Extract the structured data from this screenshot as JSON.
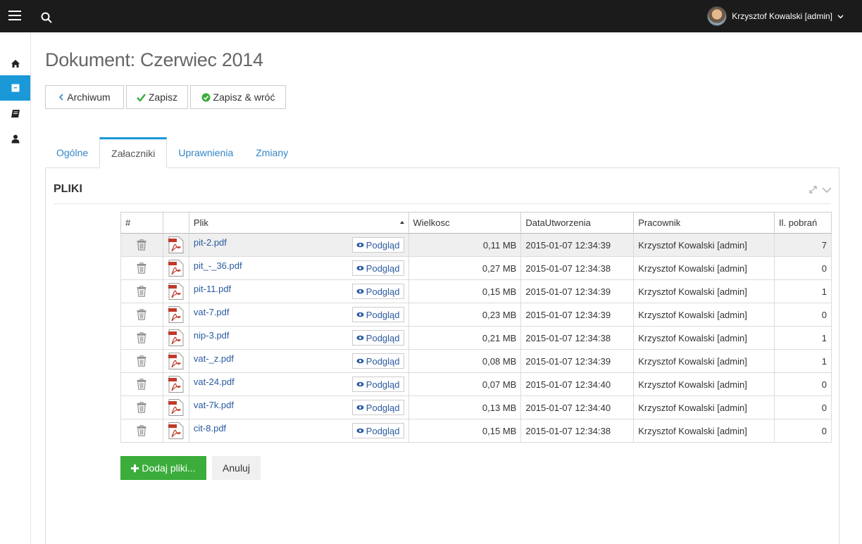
{
  "topbar": {
    "user_name": "Krzysztof Kowalski [admin]"
  },
  "page": {
    "title": "Dokument: Czerwiec 2014"
  },
  "toolbar": {
    "archive_label": "Archiwum",
    "save_label": "Zapisz",
    "save_back_label": "Zapisz & wróć"
  },
  "tabs": [
    {
      "label": "Ogólne"
    },
    {
      "label": "Załaczniki"
    },
    {
      "label": "Uprawnienia"
    },
    {
      "label": "Zmiany"
    }
  ],
  "panel": {
    "title": "PLIKI"
  },
  "table": {
    "headers": {
      "index": "#",
      "file": "Plik",
      "size": "Wielkosc",
      "created": "DataUtworzenia",
      "employee": "Pracownik",
      "downloads": "Il. pobrań"
    },
    "preview_label": "Podgląd",
    "rows": [
      {
        "file": "pit-2.pdf",
        "size": "0,11 MB",
        "created": "2015-01-07 12:34:39",
        "employee": "Krzysztof Kowalski [admin]",
        "downloads": "7"
      },
      {
        "file": "pit_-_36.pdf",
        "size": "0,27 MB",
        "created": "2015-01-07 12:34:38",
        "employee": "Krzysztof Kowalski [admin]",
        "downloads": "0"
      },
      {
        "file": "pit-11.pdf",
        "size": "0,15 MB",
        "created": "2015-01-07 12:34:39",
        "employee": "Krzysztof Kowalski [admin]",
        "downloads": "1"
      },
      {
        "file": "vat-7.pdf",
        "size": "0,23 MB",
        "created": "2015-01-07 12:34:39",
        "employee": "Krzysztof Kowalski [admin]",
        "downloads": "0"
      },
      {
        "file": "nip-3.pdf",
        "size": "0,21 MB",
        "created": "2015-01-07 12:34:38",
        "employee": "Krzysztof Kowalski [admin]",
        "downloads": "1"
      },
      {
        "file": "vat-_z.pdf",
        "size": "0,08 MB",
        "created": "2015-01-07 12:34:39",
        "employee": "Krzysztof Kowalski [admin]",
        "downloads": "1"
      },
      {
        "file": "vat-24.pdf",
        "size": "0,07 MB",
        "created": "2015-01-07 12:34:40",
        "employee": "Krzysztof Kowalski [admin]",
        "downloads": "0"
      },
      {
        "file": "vat-7k.pdf",
        "size": "0,13 MB",
        "created": "2015-01-07 12:34:40",
        "employee": "Krzysztof Kowalski [admin]",
        "downloads": "0"
      },
      {
        "file": "cit-8.pdf",
        "size": "0,15 MB",
        "created": "2015-01-07 12:34:38",
        "employee": "Krzysztof Kowalski [admin]",
        "downloads": "0"
      }
    ]
  },
  "actions": {
    "add_label": "Dodaj pliki...",
    "cancel_label": "Anuluj"
  },
  "icons": {
    "menu": "hamburger-icon",
    "search": "search-icon",
    "home": "home-icon",
    "archive": "archive-box-icon",
    "book": "book-icon",
    "user": "user-icon",
    "delete": "trash-icon",
    "pdf": "pdf-file-icon",
    "preview": "eye-icon",
    "expand": "expand-icon",
    "collapse": "chevron-down-icon"
  },
  "colors": {
    "accent": "#1a98d8",
    "topbar": "#1b1b1b",
    "success": "#3aad3a",
    "link": "#3385c5"
  }
}
